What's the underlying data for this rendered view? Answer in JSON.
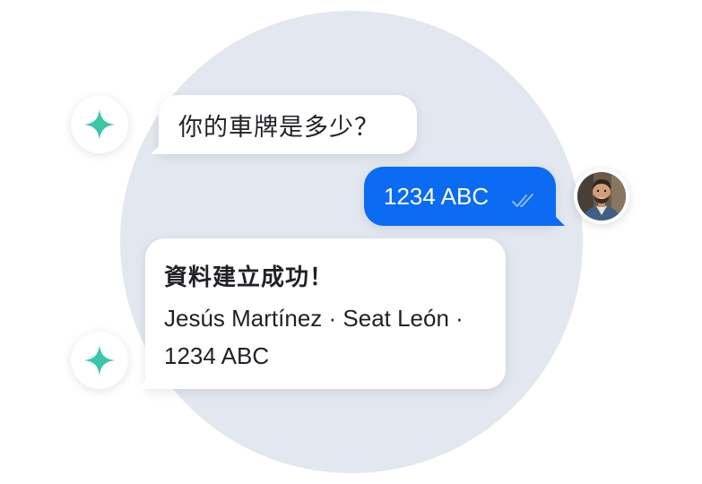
{
  "conversation": {
    "question": "你的車牌是多少？",
    "answer": "1234 ABC",
    "confirmation_title": "資料建立成功！",
    "confirmation_body": "Jesús Martínez · Seat León · 1234 ABC"
  },
  "icons": {
    "bot_avatar": "sparkle-icon",
    "read_receipt": "double-check-icon",
    "user_avatar": "user-photo"
  },
  "colors": {
    "background_circle": "#e3e7ef",
    "user_bubble": "#0b6bf2",
    "bot_bubble": "#ffffff",
    "sparkle": "#3cc6a8",
    "text": "#1f2126"
  }
}
